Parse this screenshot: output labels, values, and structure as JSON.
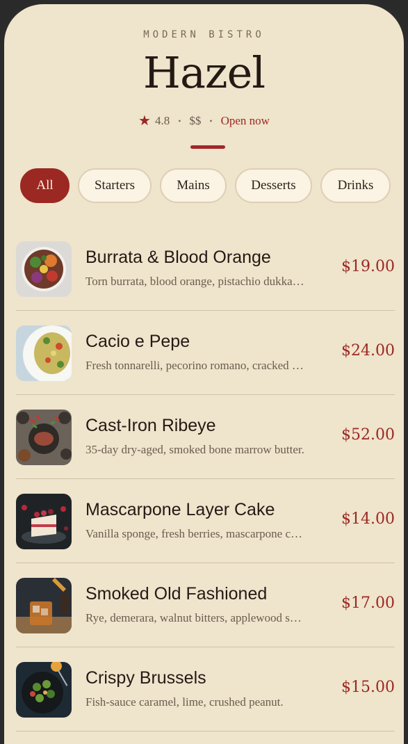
{
  "header": {
    "eyebrow": "MODERN BISTRO",
    "title": "Hazel",
    "rating": "4.8",
    "price_level": "$$",
    "status": "Open now",
    "separator": "•"
  },
  "tabs": [
    {
      "label": "All",
      "active": true
    },
    {
      "label": "Starters",
      "active": false
    },
    {
      "label": "Mains",
      "active": false
    },
    {
      "label": "Desserts",
      "active": false
    },
    {
      "label": "Drinks",
      "active": false
    }
  ],
  "menu": {
    "items": [
      {
        "name": "Burrata & Blood Orange",
        "description": "Torn burrata, blood orange, pistachio dukkah, basil oil.",
        "price": "$19.00",
        "image": "salad-bowl-photo"
      },
      {
        "name": "Cacio e Pepe",
        "description": "Fresh tonnarelli, pecorino romano, cracked black pepper.",
        "price": "$24.00",
        "image": "pasta-plate-photo"
      },
      {
        "name": "Cast-Iron Ribeye",
        "description": "35-day dry-aged, smoked bone marrow butter.",
        "price": "$52.00",
        "image": "steak-platter-photo"
      },
      {
        "name": "Mascarpone Layer Cake",
        "description": "Vanilla sponge, fresh berries, mascarpone cream.",
        "price": "$14.00",
        "image": "layer-cake-photo"
      },
      {
        "name": "Smoked Old Fashioned",
        "description": "Rye, demerara, walnut bitters, applewood smoke.",
        "price": "$17.00",
        "image": "cocktail-photo"
      },
      {
        "name": "Crispy Brussels",
        "description": "Fish-sauce caramel, lime, crushed peanut.",
        "price": "$15.00",
        "image": "brussels-bowl-photo"
      }
    ]
  },
  "colors": {
    "accent": "#9b2822",
    "background": "#efe4cc",
    "text": "#241a14",
    "muted": "#6a5c4e"
  }
}
